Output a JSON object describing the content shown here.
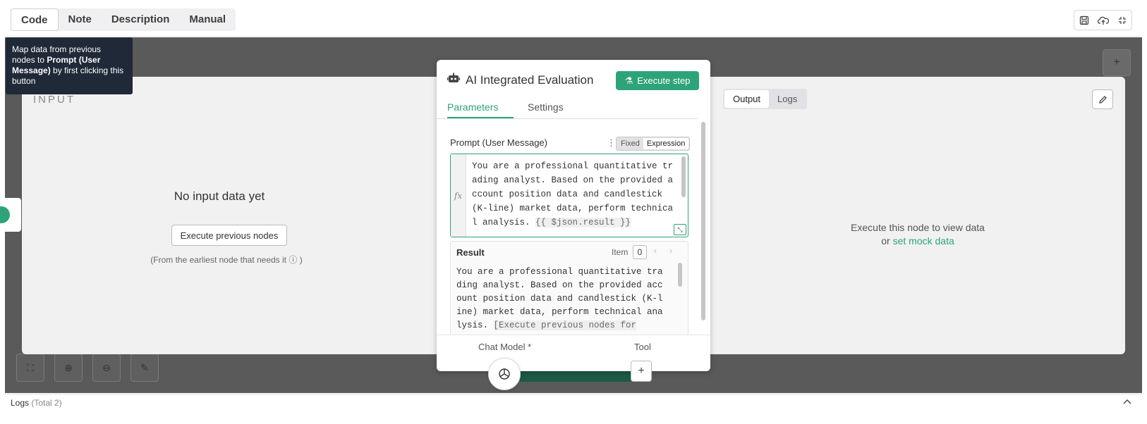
{
  "tabs": [
    {
      "label": "Code",
      "active": true
    },
    {
      "label": "Note",
      "active": false
    },
    {
      "label": "Description",
      "active": false
    },
    {
      "label": "Manual",
      "active": false
    }
  ],
  "tooltip": {
    "prefix": "Map data from previous nodes to ",
    "bold": "Prompt (User Message)",
    "suffix": " by first clicking this button"
  },
  "input_panel": {
    "title": "INPUT",
    "empty_title": "No input data yet",
    "execute_button": "Execute previous nodes",
    "note": "(From the earliest node that needs it",
    "note_end": ")"
  },
  "node": {
    "title": "AI Integrated Evaluation",
    "execute_step": "Execute step",
    "tabs": [
      "Parameters",
      "Settings"
    ],
    "prompt_label": "Prompt (User Message)",
    "mode_fixed": "Fixed",
    "mode_expression": "Expression",
    "prompt_text": "You are a professional quantitative trading analyst. Based on the provided account position data and candlestick (K-line) market data, perform technical analysis. ",
    "prompt_expression": "{{ $json.result }}",
    "result_label": "Result",
    "item_label": "Item",
    "item_index": "0",
    "result_text": "You are a professional quantitative trading analyst. Based on the provided account position data and candlestick (K-line) market data, perform technical analysis. ",
    "result_expression": "[Execute previous nodes for",
    "chat_model_label": "Chat Model *",
    "tool_label": "Tool"
  },
  "output_panel": {
    "tabs": [
      {
        "label": "Output",
        "active": true
      },
      {
        "label": "Logs",
        "active": false
      }
    ],
    "empty_line1": "Execute this node to view data",
    "empty_or": "or ",
    "mock_link": "set mock data"
  },
  "logs_bar": {
    "label": "Logs",
    "total": "(Total 2)"
  },
  "colors": {
    "accent": "#2ea37a",
    "canvas": "#5a5a5a",
    "tooltip_bg": "#1f2937"
  }
}
